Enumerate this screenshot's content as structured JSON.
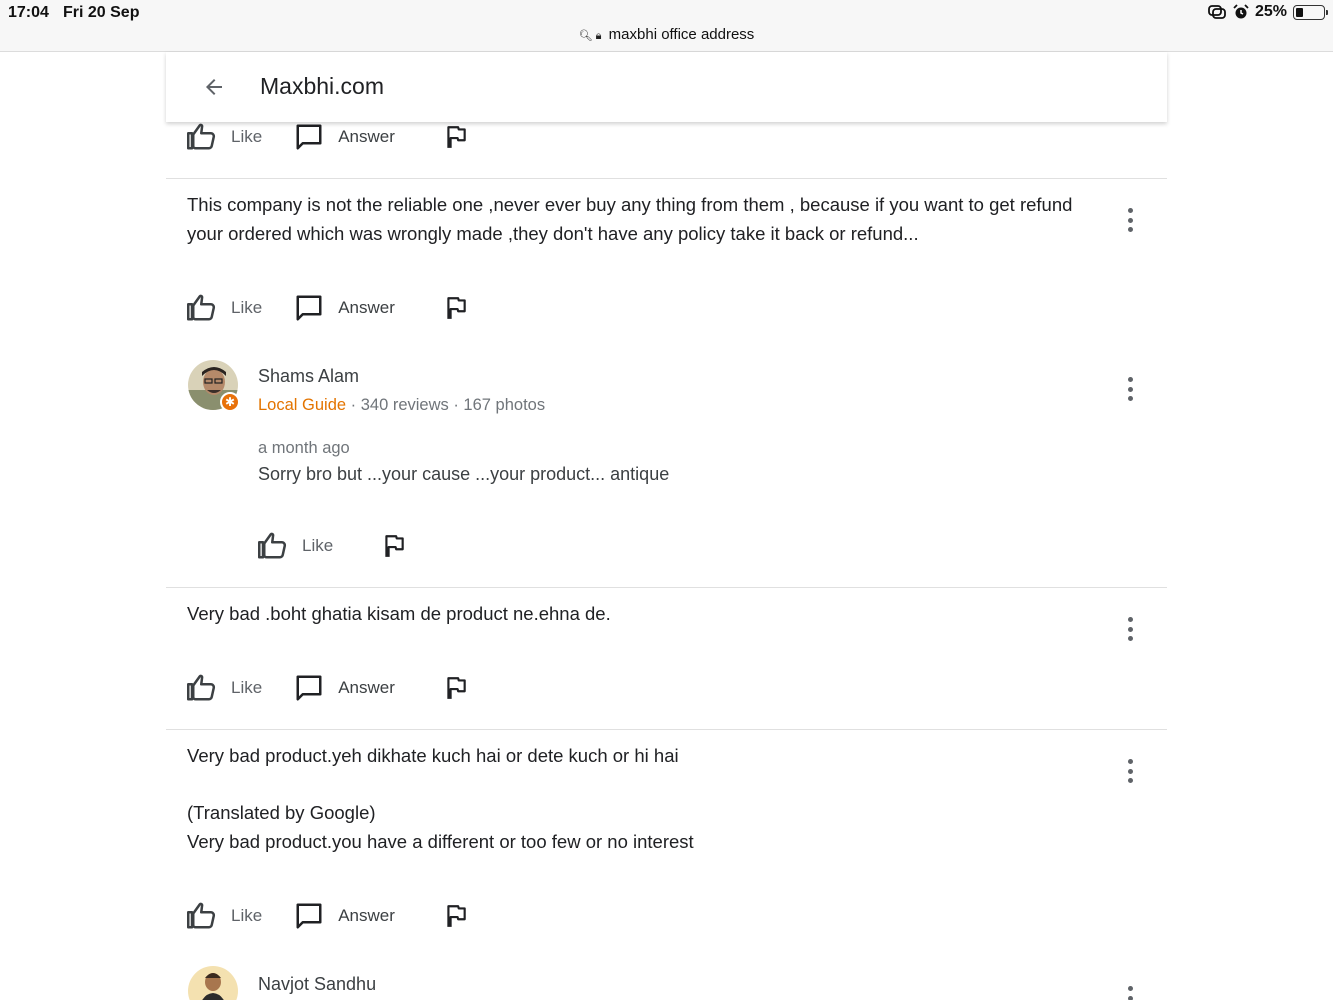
{
  "status_bar": {
    "time": "17:04",
    "date": "Fri 20 Sep",
    "url": "maxbhi office address",
    "battery_percent": "25%",
    "battery_level": 0.25
  },
  "header": {
    "title": "Maxbhi.com"
  },
  "actions": {
    "like": "Like",
    "answer": "Answer"
  },
  "reviews": [
    {
      "text": "This company is not the reliable one ,never ever buy any thing from them , because if you want to get refund your ordered which was wrongly made ,they don't have any policy take it back or refund..."
    },
    {
      "name": "Shams Alam",
      "badge": "Local Guide",
      "stats": " · 340 reviews · 167 photos",
      "age": "a month ago",
      "text": "Sorry bro but ...your cause ...your product... antique"
    },
    {
      "text": "Very bad .boht ghatia kisam de product ne.ehna de."
    },
    {
      "text": "Very bad product.yeh dikhate kuch hai or dete kuch or hi hai",
      "translated_label": "(Translated by Google)",
      "translated_text": "Very bad product.you have a different or too few or no interest"
    },
    {
      "name": "Navjot Sandhu"
    }
  ],
  "colors": {
    "local_guide": "#e37400",
    "icon": "#3c4043",
    "divider": "#e0e0e0"
  }
}
